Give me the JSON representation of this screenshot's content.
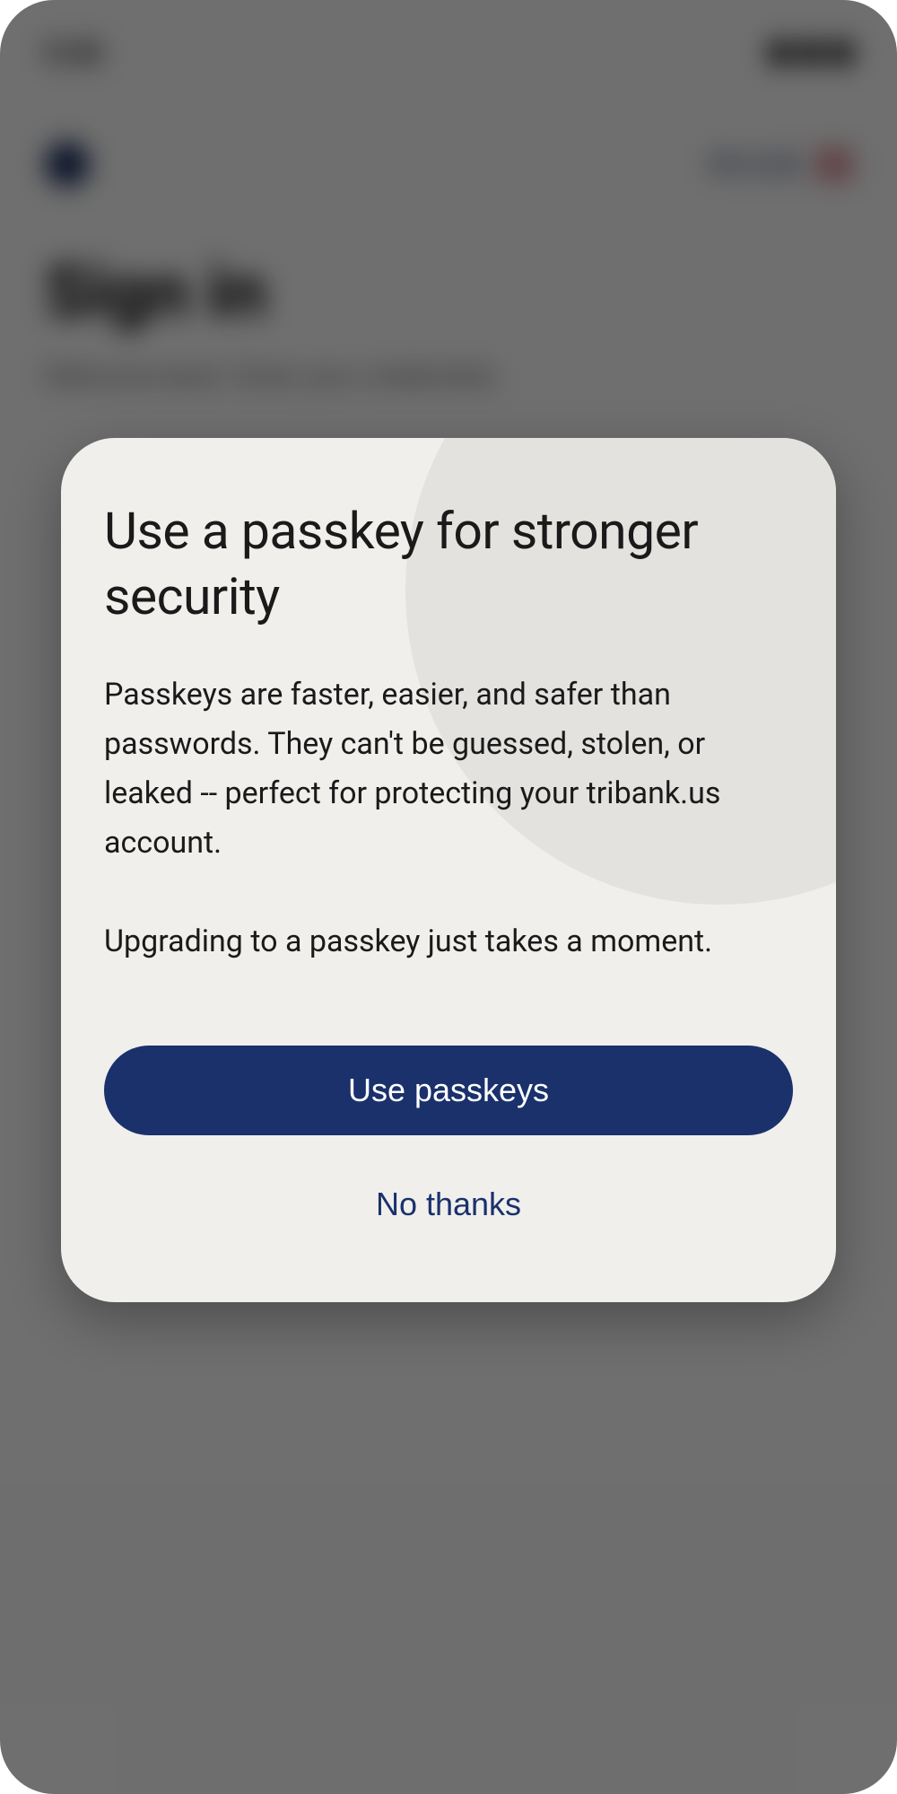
{
  "background": {
    "time": "9:30",
    "language_label": "EN (US)",
    "page_title": "Sign in",
    "page_subtitle": "Welcome back. Enter your credentials."
  },
  "modal": {
    "title": "Use a passkey for stronger security",
    "body_p1": "Passkeys are faster, easier, and safer than passwords. They can't be guessed, stolen, or leaked -- perfect for protecting your tribank.us account.",
    "body_p2": "Upgrading to a passkey just takes a moment.",
    "primary_label": "Use passkeys",
    "secondary_label": "No thanks"
  }
}
